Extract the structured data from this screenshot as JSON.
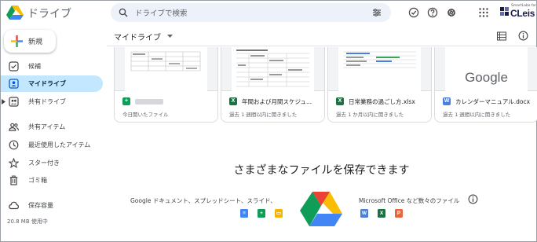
{
  "app": {
    "title": "ドライブ"
  },
  "search": {
    "placeholder": "ドライブで検索"
  },
  "brand": {
    "small": "SmartLabo for",
    "big": "CLeis"
  },
  "sidebar": {
    "new_label": "新規",
    "items": [
      {
        "label": "候補",
        "icon": "check-circle-icon"
      },
      {
        "label": "マイドライブ",
        "icon": "my-drive-icon",
        "active": true
      },
      {
        "label": "共有ドライブ",
        "icon": "shared-drives-icon"
      },
      {
        "label": "共有アイテム",
        "icon": "people-icon"
      },
      {
        "label": "最近使用したアイテム",
        "icon": "clock-icon"
      },
      {
        "label": "スター付き",
        "icon": "star-icon"
      },
      {
        "label": "ゴミ箱",
        "icon": "trash-icon"
      },
      {
        "label": "保存容量",
        "icon": "cloud-icon"
      }
    ],
    "storage_used": "20.8 MB 使用中"
  },
  "main": {
    "breadcrumb": "マイドライブ",
    "files": [
      {
        "name": "",
        "type": "sheets",
        "meta": "今日開いたファイル"
      },
      {
        "name": "年間および月間スケジュ...",
        "type": "excel",
        "meta": "過去 1 週間以内に開きました"
      },
      {
        "name": "日常業務の過ごし方.xlsx",
        "type": "excel",
        "meta": "過去 1 か月以内に開きました"
      },
      {
        "name": "カレンダーマニュアル.docx",
        "type": "word",
        "meta": "過去 1 週間以内に開きました",
        "thumb_text": "Google"
      }
    ],
    "empty_title": "さまざまなファイルを保存できます",
    "promo_left": "Google ドキュメント、スプレッドシート、スライド、",
    "promo_right": "Microsoft Office など数々のファイル"
  },
  "colors": {
    "accent": "#c2e7ff",
    "sheets": "#0f9d58",
    "excel": "#1d7044",
    "word": "#4a7fdd",
    "slides": "#f4b400",
    "powerpoint": "#e8673c"
  }
}
